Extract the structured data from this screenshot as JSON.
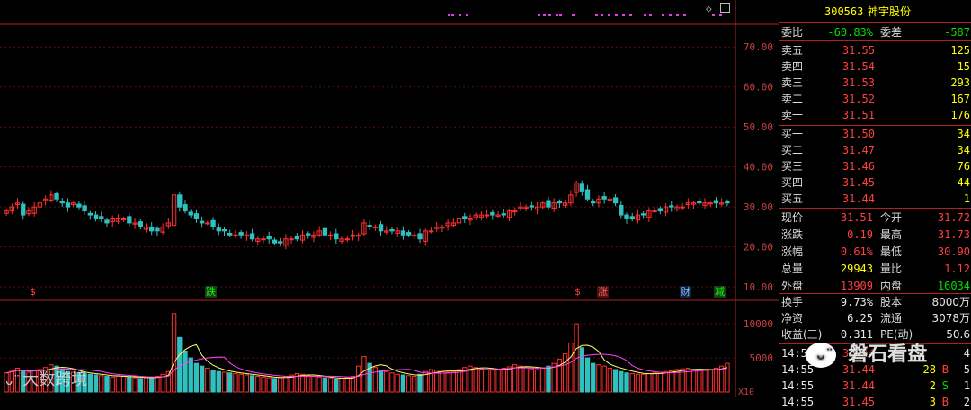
{
  "chart_data": {
    "type": "candlestick",
    "price_axis": {
      "ticks": [
        "70.00",
        "60.00",
        "50.00",
        "40.00",
        "30.00",
        "20.00",
        "10.00"
      ],
      "ylim": [
        8,
        75
      ]
    },
    "volume_axis": {
      "ticks": [
        "10000",
        "5000"
      ],
      "unit_label": "X10"
    },
    "close_series": [
      29,
      30,
      31,
      28,
      29,
      30,
      31,
      32,
      33,
      32,
      31,
      30,
      31,
      30,
      29,
      28,
      27,
      27,
      26,
      27,
      27,
      27,
      26,
      26,
      25,
      25,
      24,
      24,
      25,
      26,
      33,
      30,
      29,
      28,
      27,
      26,
      26,
      25,
      24,
      24,
      23,
      23,
      23,
      23,
      22,
      22,
      22,
      22,
      21,
      21,
      22,
      22,
      22,
      23,
      23,
      23,
      24,
      23,
      23,
      22,
      22,
      22,
      23,
      23,
      26,
      25,
      25,
      24,
      24,
      24,
      24,
      23,
      23,
      23,
      22,
      24,
      24,
      25,
      25,
      26,
      26,
      27,
      27,
      27,
      28,
      28,
      28,
      28,
      28,
      28,
      29,
      29,
      30,
      30,
      30,
      30,
      31,
      30,
      31,
      31,
      31,
      33,
      36,
      34,
      32,
      31,
      32,
      32,
      32,
      31,
      28,
      27,
      27,
      28,
      28,
      29,
      29,
      29,
      30,
      30,
      30,
      30,
      31,
      31,
      31,
      31,
      31,
      31,
      31,
      31
    ],
    "volume_series": [
      280,
      320,
      350,
      300,
      290,
      310,
      330,
      360,
      400,
      380,
      340,
      300,
      290,
      280,
      270,
      260,
      250,
      240,
      230,
      220,
      240,
      230,
      220,
      210,
      200,
      210,
      220,
      230,
      260,
      300,
      1150,
      800,
      600,
      500,
      420,
      380,
      350,
      320,
      300,
      290,
      280,
      270,
      260,
      250,
      240,
      230,
      220,
      210,
      200,
      210,
      230,
      250,
      270,
      260,
      240,
      230,
      220,
      210,
      200,
      190,
      200,
      210,
      230,
      380,
      520,
      420,
      360,
      320,
      300,
      280,
      260,
      250,
      240,
      230,
      260,
      300,
      330,
      320,
      300,
      290,
      300,
      330,
      360,
      380,
      360,
      340,
      330,
      320,
      330,
      350,
      370,
      400,
      380,
      360,
      340,
      330,
      350,
      380,
      420,
      480,
      560,
      720,
      1000,
      650,
      500,
      420,
      400,
      380,
      350,
      330,
      300,
      280,
      270,
      260,
      260,
      270,
      280,
      290,
      300,
      310,
      330,
      340,
      350,
      330,
      320,
      320,
      330,
      350,
      380,
      420
    ]
  },
  "markers": [
    {
      "text": "$",
      "color": "#ff4040",
      "bg": "none"
    },
    {
      "text": "跌",
      "color": "#00ff00",
      "bg": "#1a3a1a"
    },
    {
      "text": "$",
      "color": "#ff4040",
      "bg": "none"
    },
    {
      "text": "涨",
      "color": "#ff6060",
      "bg": "#4a1010"
    },
    {
      "text": "财",
      "color": "#80c0ff",
      "bg": "#10203a"
    },
    {
      "text": "减",
      "color": "#00ff00",
      "bg": "#1a3a1a"
    }
  ],
  "panel": {
    "code": "300563",
    "name": "神宇股份",
    "weibi_label": "委比",
    "weibi": "-60.83%",
    "weicha_label": "委差",
    "weicha": "-587",
    "sells": [
      {
        "label": "卖五",
        "price": "31.55",
        "vol": "125"
      },
      {
        "label": "卖四",
        "price": "31.54",
        "vol": "15"
      },
      {
        "label": "卖三",
        "price": "31.53",
        "vol": "293"
      },
      {
        "label": "卖二",
        "price": "31.52",
        "vol": "167"
      },
      {
        "label": "卖一",
        "price": "31.51",
        "vol": "176"
      }
    ],
    "buys": [
      {
        "label": "买一",
        "price": "31.50",
        "vol": "34"
      },
      {
        "label": "买二",
        "price": "31.47",
        "vol": "34"
      },
      {
        "label": "买三",
        "price": "31.46",
        "vol": "76"
      },
      {
        "label": "买四",
        "price": "31.45",
        "vol": "44"
      },
      {
        "label": "买五",
        "price": "31.44",
        "vol": "1"
      }
    ],
    "stats": [
      {
        "l1": "现价",
        "v1": "31.51",
        "c1": "red",
        "l2": "今开",
        "v2": "31.72",
        "c2": "red"
      },
      {
        "l1": "涨跌",
        "v1": "0.19",
        "c1": "red",
        "l2": "最高",
        "v2": "31.73",
        "c2": "red"
      },
      {
        "l1": "涨幅",
        "v1": "0.61%",
        "c1": "red",
        "l2": "最低",
        "v2": "30.90",
        "c2": "red"
      },
      {
        "l1": "总量",
        "v1": "29943",
        "c1": "yellow",
        "l2": "量比",
        "v2": "1.12",
        "c2": "red"
      },
      {
        "l1": "外盘",
        "v1": "13909",
        "c1": "red",
        "l2": "内盘",
        "v2": "16034",
        "c2": "green"
      }
    ],
    "stats2": [
      {
        "l1": "换手",
        "v1": "9.73%",
        "l2": "股本",
        "v2": "8000万"
      },
      {
        "l1": "净资",
        "v1": "6.25",
        "l2": "流通",
        "v2": "3078万"
      },
      {
        "l1": "收益(三)",
        "v1": "0.311",
        "l2": "PE(动)",
        "v2": "50.6"
      }
    ],
    "ticks": [
      {
        "time": "14:55",
        "price": "31.44",
        "vol": "",
        "side": "",
        "n": "4"
      },
      {
        "time": "14:55",
        "price": "31.44",
        "vol": "28",
        "side": "B",
        "n": "5"
      },
      {
        "time": "14:55",
        "price": "31.44",
        "vol": "2",
        "side": "S",
        "n": "1"
      },
      {
        "time": "14:55",
        "price": "31.45",
        "vol": "3",
        "side": "B",
        "n": "2"
      }
    ]
  },
  "watermarks": {
    "left": "大数跨境",
    "right": "磐石看盘"
  }
}
